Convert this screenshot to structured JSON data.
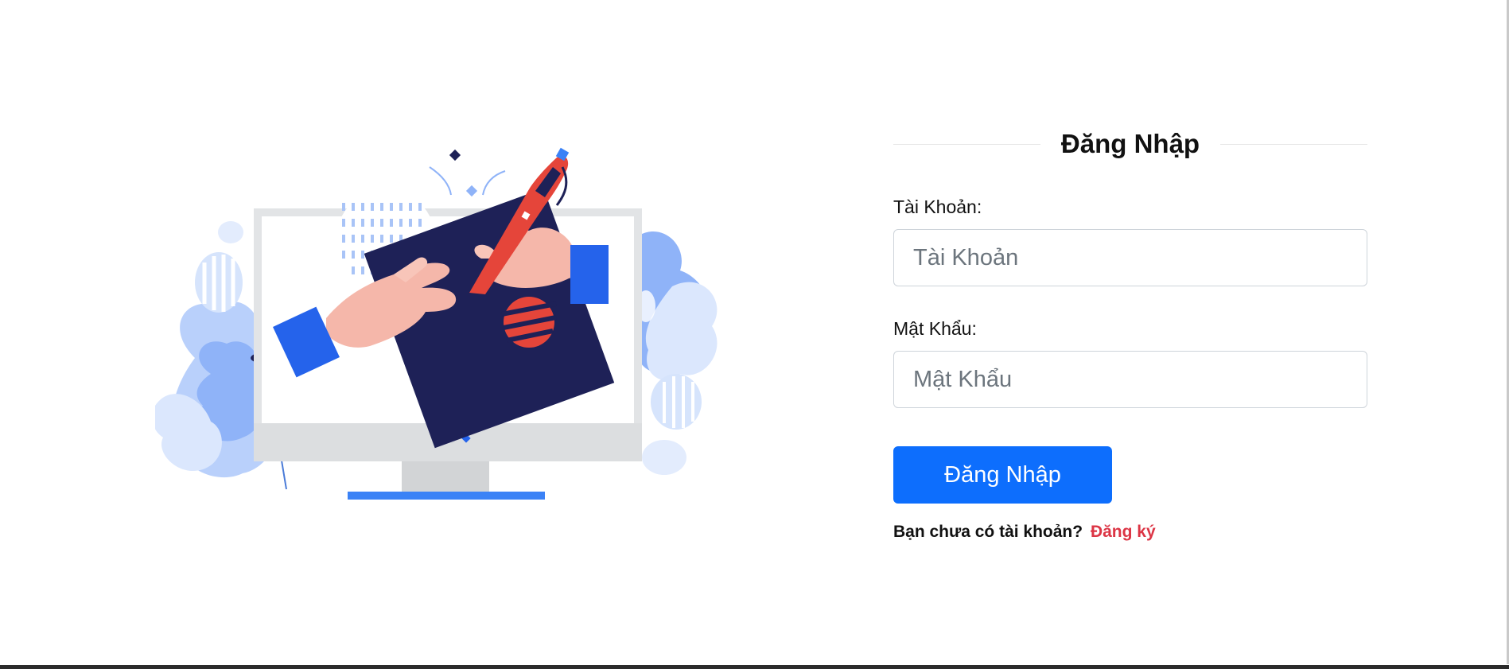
{
  "form": {
    "title": "Đăng Nhập",
    "account_label": "Tài Khoản:",
    "account_placeholder": "Tài Khoản",
    "account_value": "",
    "password_label": "Mật Khẩu:",
    "password_placeholder": "Mật Khẩu",
    "password_value": "",
    "submit_label": "Đăng Nhập",
    "signup_prompt": "Bạn chưa có tài khoản?",
    "signup_link": "Đăng ký"
  },
  "colors": {
    "primary": "#0d6efd",
    "link_red": "#dc3545",
    "illustration_navy": "#1e2157",
    "illustration_blue": "#3b82f6",
    "illustration_red": "#e5453a"
  },
  "illustration": {
    "icon": "monitor-drawing-illustration"
  }
}
